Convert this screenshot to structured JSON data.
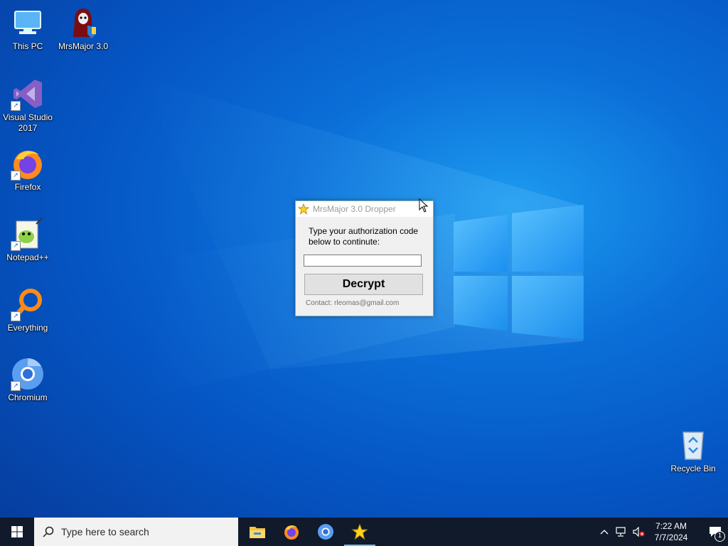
{
  "desktop": {
    "icons": [
      {
        "label": "This PC"
      },
      {
        "label": "MrsMajor 3.0"
      },
      {
        "label": "Visual Studio 2017"
      },
      {
        "label": "Firefox"
      },
      {
        "label": "Notepad++"
      },
      {
        "label": "Everything"
      },
      {
        "label": "Chromium"
      },
      {
        "label": "Recycle Bin"
      }
    ]
  },
  "dialog": {
    "title": "MrsMajor 3.0 Dropper",
    "prompt": "Type your authorization code below to continute:",
    "input_value": "",
    "button_label": "Decrypt",
    "contact": "Contact: rleomas@gmail.com"
  },
  "taskbar": {
    "search_placeholder": "Type here to search",
    "apps": [
      {
        "icon": "file-explorer-icon"
      },
      {
        "icon": "firefox-icon"
      },
      {
        "icon": "chromium-icon"
      },
      {
        "icon": "mrsmajor-star-icon",
        "active": true
      }
    ],
    "clock_time": "7:22 AM",
    "clock_date": "7/7/2024",
    "notification_count": "1"
  },
  "colors": {
    "desktop_bg": "#0b6fd8",
    "taskbar_bg": "#101a2b",
    "accent": "#76b9ed"
  }
}
